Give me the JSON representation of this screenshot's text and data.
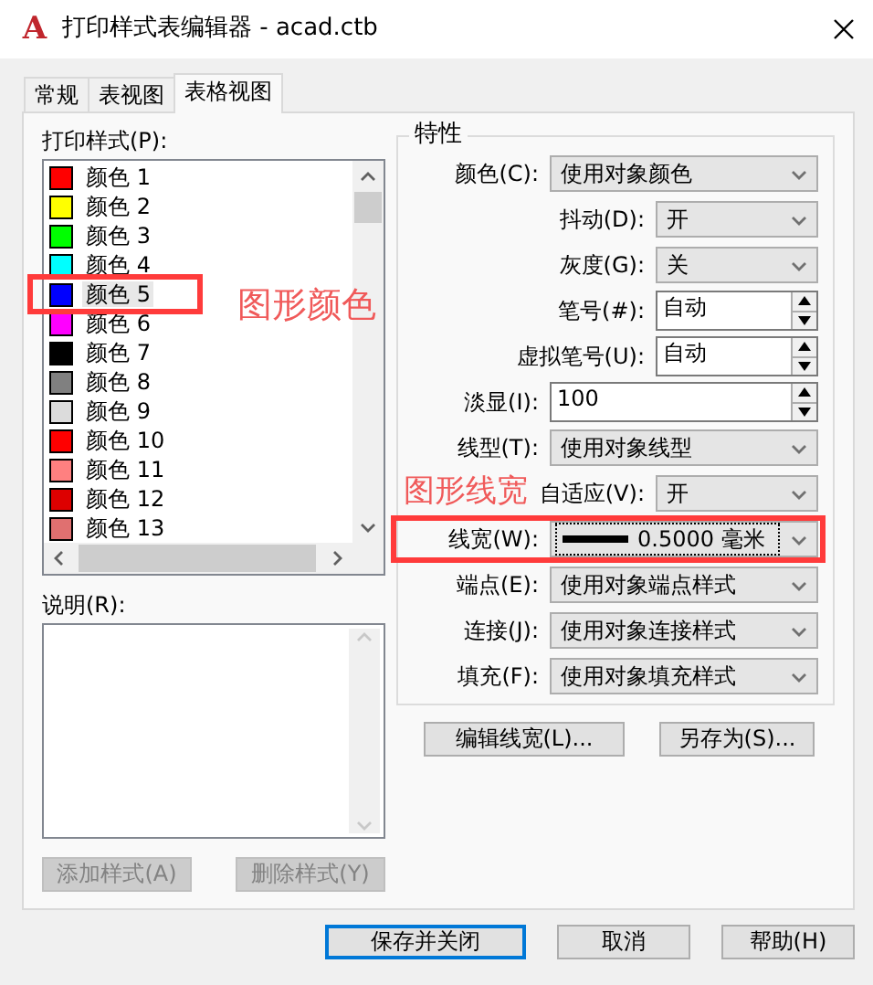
{
  "window": {
    "app_icon_letter": "A",
    "title": "打印样式表编辑器 - acad.ctb"
  },
  "tabs": [
    {
      "label": "常规",
      "selected": false
    },
    {
      "label": "表视图",
      "selected": false
    },
    {
      "label": "表格视图",
      "selected": true
    }
  ],
  "print_styles": {
    "label": "打印样式(P):",
    "items": [
      {
        "name": "颜色 1",
        "color": "#ff0000",
        "selected": false
      },
      {
        "name": "颜色 2",
        "color": "#ffff00",
        "selected": false
      },
      {
        "name": "颜色 3",
        "color": "#00ff00",
        "selected": false
      },
      {
        "name": "颜色 4",
        "color": "#00ffff",
        "selected": false
      },
      {
        "name": "颜色 5",
        "color": "#0000ff",
        "selected": true
      },
      {
        "name": "颜色 6",
        "color": "#ff00ff",
        "selected": false
      },
      {
        "name": "颜色 7",
        "color": "#000000",
        "selected": false
      },
      {
        "name": "颜色 8",
        "color": "#808080",
        "selected": false
      },
      {
        "name": "颜色 9",
        "color": "#dcdcdc",
        "selected": false
      },
      {
        "name": "颜色 10",
        "color": "#ff0000",
        "selected": false
      },
      {
        "name": "颜色 11",
        "color": "#ff8080",
        "selected": false
      },
      {
        "name": "颜色 12",
        "color": "#dd0000",
        "selected": false
      },
      {
        "name": "颜色 13",
        "color": "#e07070",
        "selected": false
      }
    ]
  },
  "description": {
    "label": "说明(R):"
  },
  "style_buttons": [
    {
      "label": "添加样式(A)",
      "disabled": true
    },
    {
      "label": "删除样式(Y)",
      "disabled": true
    }
  ],
  "properties": {
    "title": "特性",
    "fields": [
      {
        "kind": "select",
        "label": "颜色(C):",
        "value": "使用对象颜色"
      },
      {
        "kind": "short-select",
        "label": "抖动(D):",
        "value": "开"
      },
      {
        "kind": "short-select",
        "label": "灰度(G):",
        "value": "关"
      },
      {
        "kind": "short-spinner",
        "label": "笔号(#):",
        "value": "自动"
      },
      {
        "kind": "short-spinner",
        "label": "虚拟笔号(U):",
        "value": "自动"
      },
      {
        "kind": "spinner",
        "label": "淡显(I):",
        "value": "100"
      },
      {
        "kind": "select",
        "label": "线型(T):",
        "value": "使用对象线型"
      },
      {
        "kind": "short-select",
        "label": "自适应(V):",
        "value": "开"
      },
      {
        "kind": "lineweight",
        "label": "线宽(W):",
        "value": "0.5000 毫米"
      },
      {
        "kind": "select",
        "label": "端点(E):",
        "value": "使用对象端点样式"
      },
      {
        "kind": "select",
        "label": "连接(J):",
        "value": "使用对象连接样式"
      },
      {
        "kind": "select",
        "label": "填充(F):",
        "value": "使用对象填充样式"
      }
    ]
  },
  "property_buttons": [
    "编辑线宽(L)...",
    "另存为(S)..."
  ],
  "dialog_buttons": [
    {
      "label": "保存并关闭",
      "default": true
    },
    {
      "label": "取消",
      "default": false
    },
    {
      "label": "帮助(H)",
      "default": false
    }
  ],
  "annotations": [
    {
      "text": "图形颜色",
      "kind": "list"
    },
    {
      "text": "图形线宽",
      "kind": "field"
    }
  ]
}
